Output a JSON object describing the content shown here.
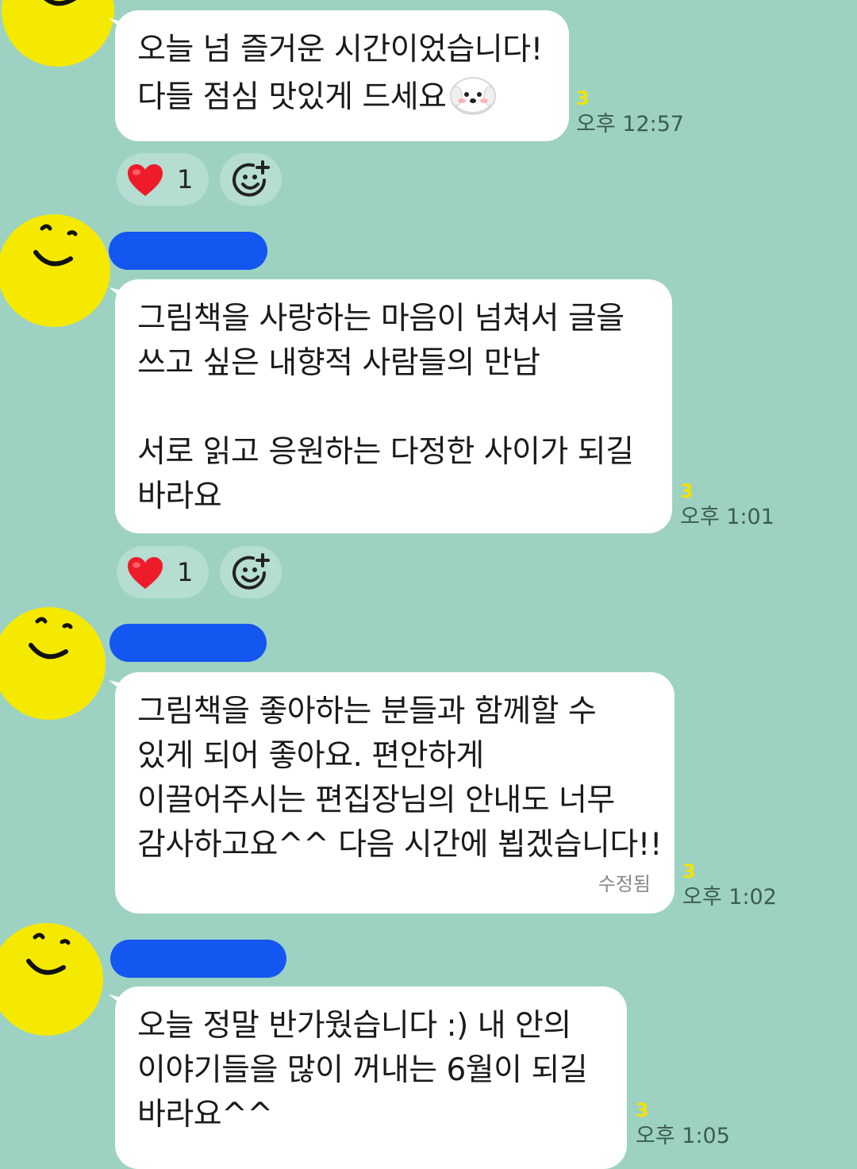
{
  "colors": {
    "background": "#9dd2c2",
    "bubble": "#ffffff",
    "avatar": "#f6e900",
    "name_redaction": "#1356f0",
    "unread_count": "#f2e200",
    "heart": "#ee1c2b"
  },
  "icons": {
    "avatar": "smiley-face-icon",
    "emoji": "white-dog-emoji-icon",
    "reaction": "heart-icon",
    "add_reaction": "add-emoji-reaction-icon"
  },
  "messages": [
    {
      "sender_redacted": true,
      "lines": [
        "오늘 넘 즐거운 시간이었습니다!",
        "다들 점심 맛있게 드세요"
      ],
      "unread": "3",
      "time": "오후 12:57",
      "reaction": {
        "emoji": "heart",
        "count": "1"
      }
    },
    {
      "sender_redacted": true,
      "lines": [
        "그림책을 사랑하는 마음이 넘쳐서 글을",
        "쓰고 싶은 내향적 사람들의 만남",
        "",
        "서로 읽고 응원하는 다정한 사이가 되길",
        "바라요"
      ],
      "unread": "3",
      "time": "오후 1:01",
      "reaction": {
        "emoji": "heart",
        "count": "1"
      }
    },
    {
      "sender_redacted": true,
      "lines": [
        "그림책을 좋아하는 분들과 함께할 수",
        "있게 되어 좋아요. 편안하게",
        "이끌어주시는 편집장님의 안내도 너무",
        "감사하고요^^ 다음 시간에 뵙겠습니다!!"
      ],
      "edited_label": "수정됨",
      "unread": "3",
      "time": "오후 1:02"
    },
    {
      "sender_redacted": true,
      "lines": [
        "오늘 정말 반가웠습니다 :) 내 안의",
        "이야기들을 많이 꺼내는 6월이 되길",
        "바라요^^"
      ],
      "unread": "3",
      "time": "오후 1:05"
    }
  ]
}
